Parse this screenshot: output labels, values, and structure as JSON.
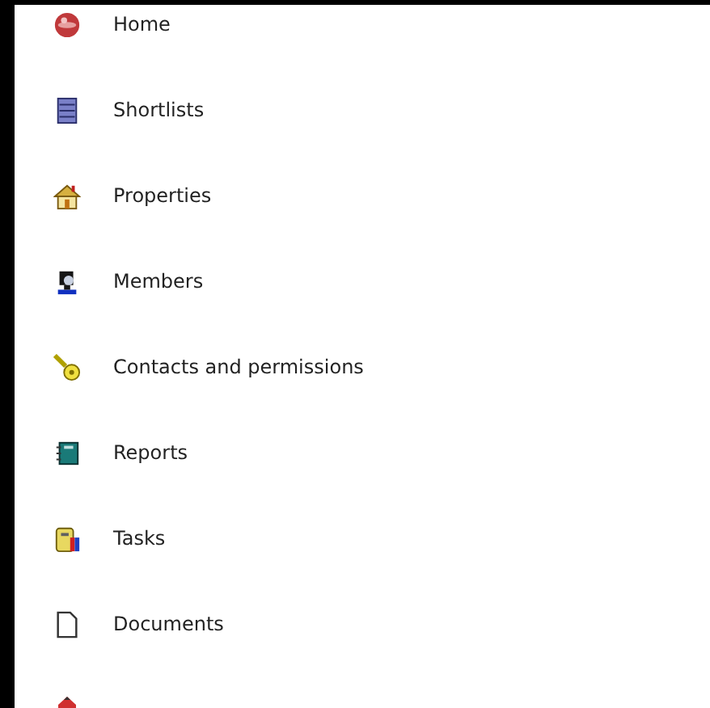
{
  "menu": {
    "items": [
      {
        "kind": "globe",
        "label": "Home"
      },
      {
        "kind": "list",
        "label": "Shortlists"
      },
      {
        "kind": "house",
        "label": "Properties"
      },
      {
        "kind": "person",
        "label": "Members"
      },
      {
        "kind": "key",
        "label": "Contacts and permissions"
      },
      {
        "kind": "notebook",
        "label": "Reports"
      },
      {
        "kind": "tasks",
        "label": "Tasks"
      },
      {
        "kind": "document",
        "label": "Documents"
      },
      {
        "kind": "pencil"
      }
    ]
  }
}
